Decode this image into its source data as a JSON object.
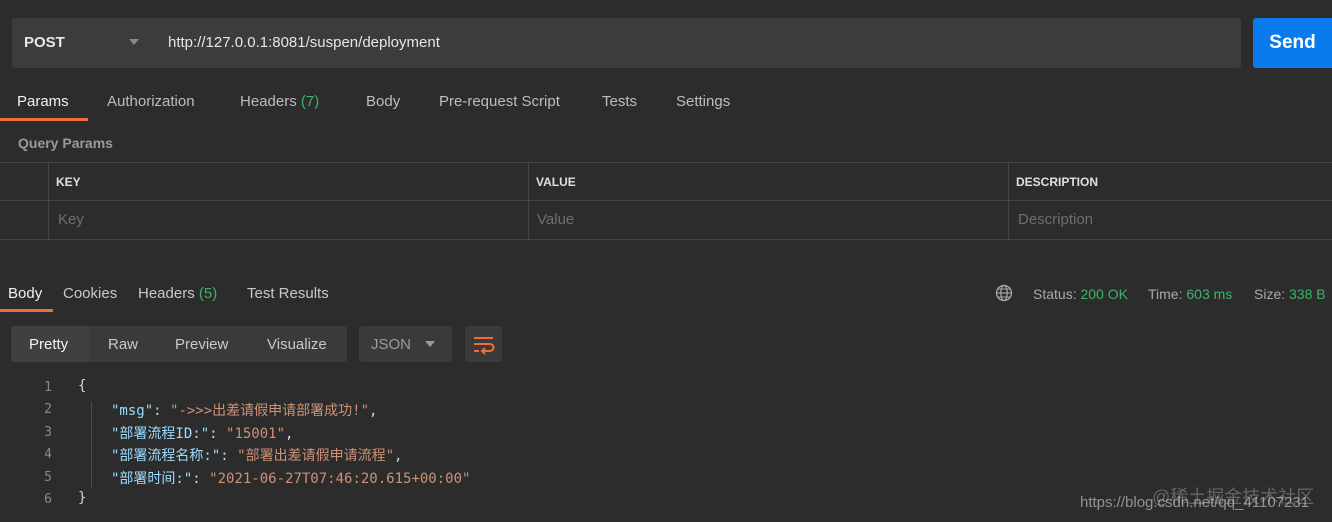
{
  "request": {
    "method": "POST",
    "url": "http://127.0.0.1:8081/suspen/deployment",
    "send_label": "Send"
  },
  "request_tabs": [
    {
      "label": "Params",
      "count": ""
    },
    {
      "label": "Authorization",
      "count": ""
    },
    {
      "label": "Headers",
      "count": "(7)"
    },
    {
      "label": "Body",
      "count": ""
    },
    {
      "label": "Pre-request Script",
      "count": ""
    },
    {
      "label": "Tests",
      "count": ""
    },
    {
      "label": "Settings",
      "count": ""
    }
  ],
  "query_params": {
    "title": "Query Params",
    "columns": [
      "KEY",
      "VALUE",
      "DESCRIPTION"
    ],
    "placeholders": [
      "Key",
      "Value",
      "Description"
    ]
  },
  "response_tabs": [
    {
      "label": "Body",
      "count": ""
    },
    {
      "label": "Cookies",
      "count": ""
    },
    {
      "label": "Headers",
      "count": "(5)"
    },
    {
      "label": "Test Results",
      "count": ""
    }
  ],
  "status": {
    "status_label": "Status:",
    "status_value": "200 OK",
    "time_label": "Time:",
    "time_value": "603 ms",
    "size_label": "Size:",
    "size_value": "338 B"
  },
  "view_modes": [
    "Pretty",
    "Raw",
    "Preview",
    "Visualize"
  ],
  "format": "JSON",
  "code_lines": [
    {
      "num": "1",
      "open": "{"
    },
    {
      "num": "2",
      "key": "\"msg\"",
      "value": "\"->>>出差请假申请部署成功!\"",
      "trail": ","
    },
    {
      "num": "3",
      "key": "\"部署流程ID:\"",
      "value": "\"15001\"",
      "trail": ","
    },
    {
      "num": "4",
      "key": "\"部署流程名称:\"",
      "value": "\"部署出差请假申请流程\"",
      "trail": ","
    },
    {
      "num": "5",
      "key": "\"部署时间:\"",
      "value": "\"2021-06-27T07:46:20.615+00:00\"",
      "trail": ""
    },
    {
      "num": "6",
      "close": "}"
    }
  ],
  "watermark": {
    "url": "https://blog.csdn.net/qq_41107231",
    "cn": "@稀土掘金技术社区"
  },
  "colors": {
    "accent": "#f26b3a",
    "send": "#097bed",
    "success": "#3fb36a"
  }
}
